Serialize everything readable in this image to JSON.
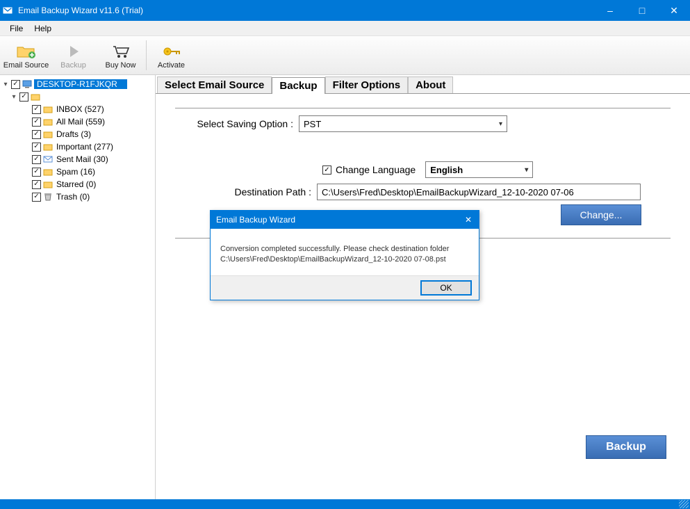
{
  "window": {
    "title": "Email Backup Wizard v11.6 (Trial)"
  },
  "menu": {
    "file": "File",
    "help": "Help"
  },
  "toolbar": {
    "email_source": "Email Source",
    "backup": "Backup",
    "buy_now": "Buy Now",
    "activate": "Activate"
  },
  "tree": {
    "root": "DESKTOP-R1FJKQR",
    "account": "",
    "items": [
      "INBOX (527)",
      "All Mail (559)",
      "Drafts (3)",
      "Important (277)",
      "Sent Mail (30)",
      "Spam (16)",
      "Starred (0)",
      "Trash (0)"
    ]
  },
  "tabs": {
    "select_source": "Select Email Source",
    "backup": "Backup",
    "filter": "Filter Options",
    "about": "About"
  },
  "form": {
    "saving_label": "Select Saving Option  :",
    "saving_value": "PST",
    "change_lang_label": "Change Language",
    "lang_value": "English",
    "dest_label": "Destination Path  :",
    "dest_value": "C:\\Users\\Fred\\Desktop\\EmailBackupWizard_12-10-2020 07-06",
    "change_btn": "Change...",
    "backup_btn": "Backup"
  },
  "dialog": {
    "title": "Email Backup Wizard",
    "line1": "Conversion completed successfully. Please check destination folder",
    "line2": "C:\\Users\\Fred\\Desktop\\EmailBackupWizard_12-10-2020 07-08.pst",
    "ok": "OK"
  }
}
